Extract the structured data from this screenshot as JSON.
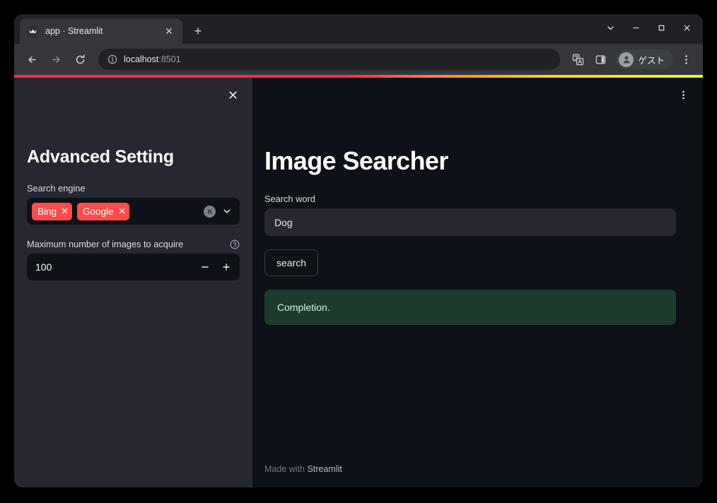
{
  "browser": {
    "tab": {
      "title": "app · Streamlit",
      "favicon_name": "streamlit-favicon",
      "close_label": "✕"
    },
    "new_tab_label": "+",
    "window_controls": {
      "tab_search_label": "⌄",
      "minimize_label": "—",
      "maximize_label": "□",
      "close_label": "✕"
    },
    "toolbar": {
      "back_label": "←",
      "forward_label": "→",
      "reload_label": "⟳",
      "site_info_label": "ⓘ",
      "url_host": "localhost",
      "url_port": ":8501",
      "translate_icon": "translate-icon",
      "side_panel_icon": "side-panel-icon",
      "profile_name": "ゲスト",
      "menu_label": "⋮"
    }
  },
  "app": {
    "accent_gradient": [
      "#ff2b4e",
      "#ff7a3c",
      "#ffd024",
      "#e8fa2e"
    ],
    "sidebar": {
      "close_label": "✕",
      "title": "Advanced Setting",
      "search_engine": {
        "label": "Search engine",
        "tags": [
          {
            "label": "Bing",
            "remove_label": "✕"
          },
          {
            "label": "Google",
            "remove_label": "✕"
          }
        ],
        "clear_label": "✕",
        "chevron_label": "⌄",
        "tag_color": "#ff4b4b"
      },
      "max_images": {
        "label": "Maximum number of images to acquire",
        "help_label": "?",
        "value": "100",
        "decrement_label": "−",
        "increment_label": "+"
      }
    },
    "main": {
      "menu_label": "⋮",
      "title": "Image Searcher",
      "search_word": {
        "label": "Search word",
        "value": "Dog",
        "placeholder": ""
      },
      "search_button_label": "search",
      "status": {
        "text": "Completion.",
        "type": "success",
        "color": "#1c3d2e"
      },
      "footer": {
        "prefix": "Made with ",
        "brand": "Streamlit"
      }
    }
  }
}
